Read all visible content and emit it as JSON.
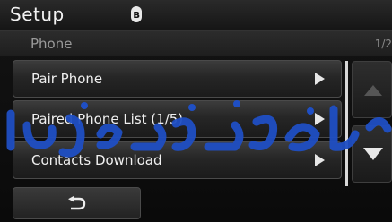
{
  "header": {
    "title": "Setup",
    "status_icon": "bluetooth-icon"
  },
  "subheader": {
    "label": "Phone",
    "page_indicator": "1/2"
  },
  "menu": {
    "items": [
      {
        "label": "Pair Phone"
      },
      {
        "label": "Paired Phone List (1/5)"
      },
      {
        "label": "Contacts Download"
      }
    ]
  },
  "controls": {
    "back_icon": "return-arrow-icon",
    "scroll_up_icon": "triangle-up-icon",
    "scroll_down_icon": "triangle-down-icon"
  },
  "watermark": {
    "text": "مداد خودرو فارسی"
  },
  "colors": {
    "background": "#0a0a0a",
    "text": "#f0f0f0",
    "watermark": "#1f4fc4"
  }
}
